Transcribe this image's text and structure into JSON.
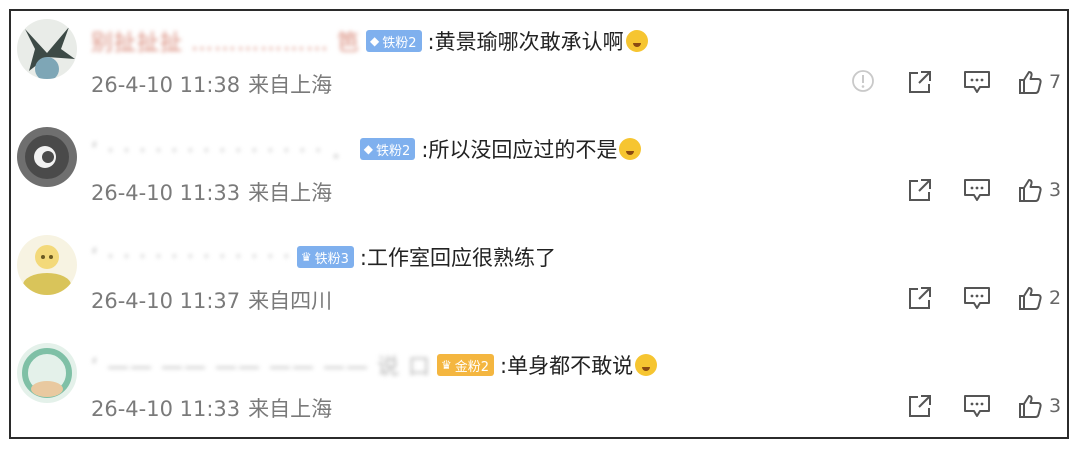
{
  "comments": [
    {
      "username": "别扯扯扯 ……………… 笆",
      "badge": "铁粉2",
      "badge_color": "blue",
      "text": ":黄景瑜哪次敢承认啊",
      "emoji": "emoji",
      "date": "26-4-10 11:38",
      "location": "来自上海",
      "likes": "7",
      "has_report": true
    },
    {
      "username": "‘ ·  ·  ·   ·   ·  ·  ·  ·  ·   ·  ·  ·  ·  ·  ．",
      "badge": "铁粉2",
      "badge_color": "blue",
      "text": ":所以没回应过的不是",
      "emoji": "emoji",
      "date": "26-4-10 11:33",
      "location": "来自上海",
      "likes": "3",
      "has_report": false
    },
    {
      "username": "‘  ·  ·  ·   ·   ·  ·  ·   ·  ·   ·  ·  ·",
      "badge": "铁粉3",
      "badge_color": "blue",
      "text": ":工作室回应很熟练了",
      "emoji": "",
      "date": "26-4-10 11:37",
      "location": "来自四川",
      "likes": "2",
      "has_report": false
    },
    {
      "username": "‘  —— ——  ——  —— —— 说 口",
      "badge": "金粉2",
      "badge_color": "gold",
      "text": ":单身都不敢说",
      "emoji": "emoji",
      "date": "26-4-10 11:33",
      "location": "来自上海",
      "likes": "3",
      "has_report": false
    }
  ],
  "icons": {
    "report": "report-icon",
    "share": "share-icon",
    "comment": "comment-icon",
    "like": "like-icon"
  },
  "colors": {
    "badge_blue": "#7fb0ee",
    "badge_gold": "#f4b640",
    "meta_gray": "#7a7a7a",
    "border": "#2b2b2b"
  }
}
